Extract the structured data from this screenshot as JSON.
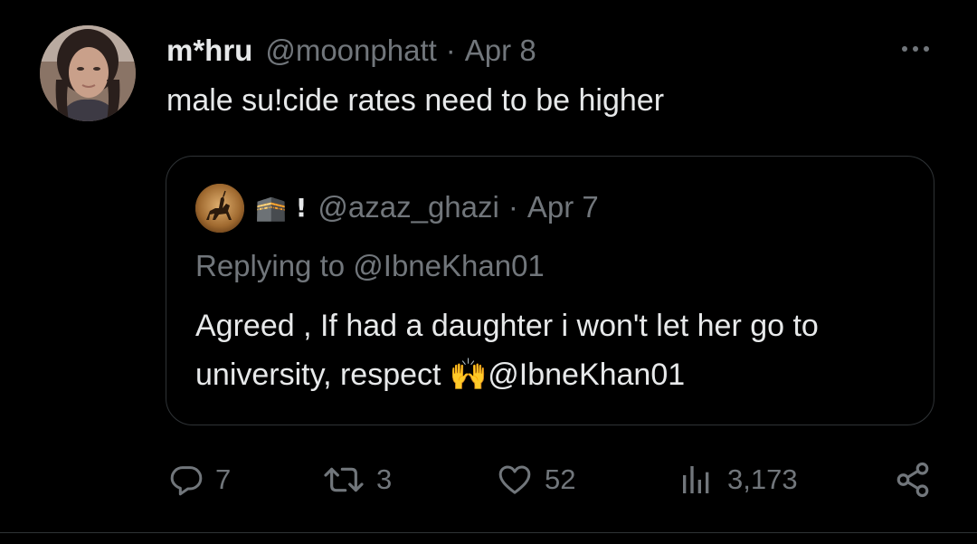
{
  "tweet": {
    "display_name": "m*hru",
    "handle": "@moonphatt",
    "separator": "·",
    "date": "Apr 8",
    "text": "male su!cide rates need to be higher",
    "avatar_icon": "user-avatar-photo",
    "more_icon": "more-dots-icon"
  },
  "quote": {
    "display_name": "🕋 !",
    "handle": "@azaz_ghazi",
    "separator": "·",
    "date": "Apr 7",
    "replying_to_prefix": "Replying to",
    "replying_to_handle": "@IbneKhan01",
    "text": "Agreed , If had a daughter i won't let her go to university, respect 🙌@IbneKhan01",
    "avatar_icon": "horse-rider-avatar"
  },
  "actions": {
    "reply_count": "7",
    "retweet_count": "3",
    "like_count": "52",
    "views_count": "3,173",
    "reply_icon": "reply-bubble-icon",
    "retweet_icon": "retweet-icon",
    "like_icon": "heart-icon",
    "views_icon": "views-bar-chart-icon",
    "share_icon": "share-icon"
  },
  "colors": {
    "background": "#000000",
    "primary_text": "#e7e9ea",
    "muted_text": "#71767b",
    "border": "#2f3336"
  }
}
